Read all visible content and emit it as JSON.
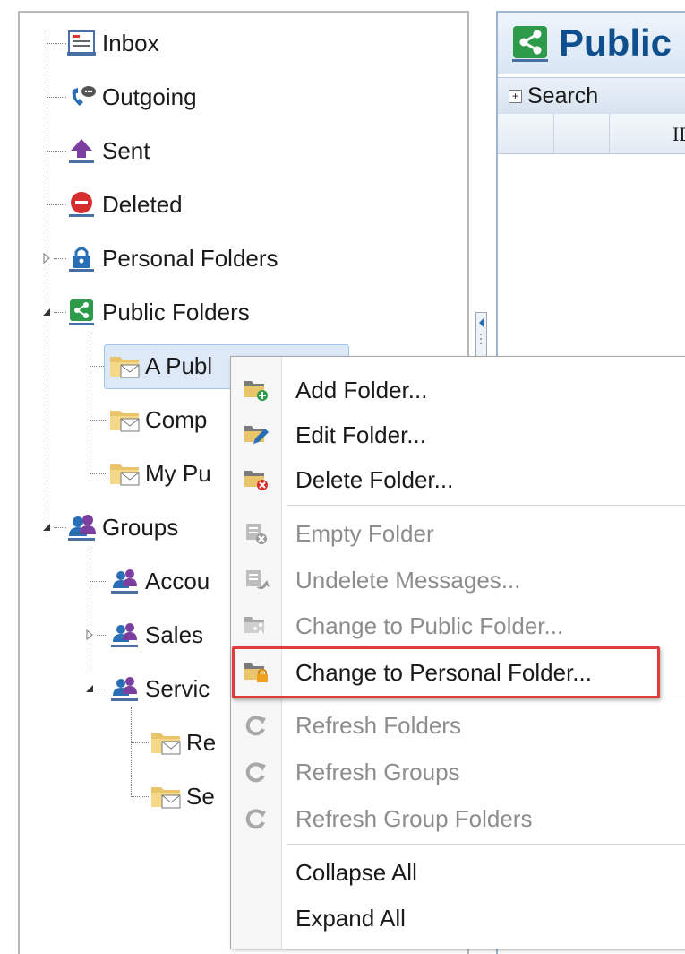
{
  "tree": {
    "nodes": [
      {
        "label": "Inbox",
        "icon": "inbox-icon"
      },
      {
        "label": "Outgoing",
        "icon": "outgoing-icon"
      },
      {
        "label": "Sent",
        "icon": "sent-icon"
      },
      {
        "label": "Deleted",
        "icon": "deleted-icon"
      },
      {
        "label": "Personal Folders",
        "icon": "lock-icon"
      },
      {
        "label": "Public Folders",
        "icon": "share-icon"
      },
      {
        "label": "A Publ",
        "icon": "folder-mail-icon"
      },
      {
        "label": "Comp",
        "icon": "folder-mail-icon"
      },
      {
        "label": "My Pu",
        "icon": "folder-mail-icon"
      },
      {
        "label": "Groups",
        "icon": "group-icon"
      },
      {
        "label": "Accou",
        "icon": "group-icon"
      },
      {
        "label": "Sales",
        "icon": "group-icon"
      },
      {
        "label": "Servic",
        "icon": "group-icon"
      },
      {
        "label": "Re",
        "icon": "folder-mail-icon"
      },
      {
        "label": "Se",
        "icon": "folder-mail-icon"
      }
    ]
  },
  "right_pane": {
    "title": "Public",
    "search_label": "Search",
    "column_label": "ID"
  },
  "context_menu": {
    "items": [
      {
        "label": "Add Folder...",
        "icon": "add-folder-icon",
        "disabled": false
      },
      {
        "label": "Edit Folder...",
        "icon": "edit-folder-icon",
        "disabled": false
      },
      {
        "label": "Delete Folder...",
        "icon": "delete-folder-icon",
        "disabled": false
      },
      {
        "label": "Empty Folder",
        "icon": "empty-folder-icon",
        "disabled": true
      },
      {
        "label": "Undelete Messages...",
        "icon": "undelete-icon",
        "disabled": true
      },
      {
        "label": "Change to Public Folder...",
        "icon": "public-folder-icon",
        "disabled": true
      },
      {
        "label": "Change to Personal Folder...",
        "icon": "personal-folder-icon",
        "disabled": false
      },
      {
        "label": "Refresh Folders",
        "icon": "refresh-icon",
        "disabled": true
      },
      {
        "label": "Refresh Groups",
        "icon": "refresh-icon",
        "disabled": true
      },
      {
        "label": "Refresh Group Folders",
        "icon": "refresh-icon",
        "disabled": true
      },
      {
        "label": "Collapse All",
        "icon": "",
        "disabled": false
      },
      {
        "label": "Expand All",
        "icon": "",
        "disabled": false
      }
    ],
    "highlighted_item": "Change to Personal Folder..."
  },
  "colors": {
    "accent": "#0f4f8e",
    "highlight_border": "#e23b3b",
    "selection_bg": "#dde9f7",
    "share_green": "#2e9b4b",
    "group_purple": "#7b3fa0"
  }
}
